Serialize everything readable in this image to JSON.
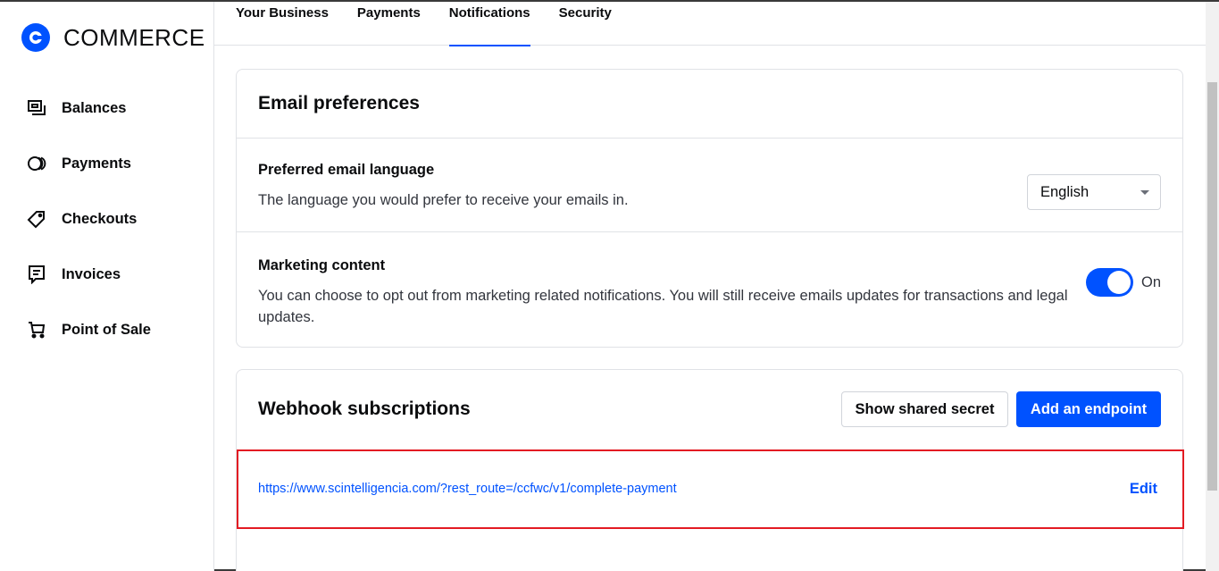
{
  "brand": {
    "name": "COMMERCE",
    "color": "#0052ff"
  },
  "sidebar": {
    "items": [
      {
        "label": "Balances",
        "icon": "balances-icon"
      },
      {
        "label": "Payments",
        "icon": "payments-icon"
      },
      {
        "label": "Checkouts",
        "icon": "checkouts-tag-icon"
      },
      {
        "label": "Invoices",
        "icon": "invoices-icon"
      },
      {
        "label": "Point of Sale",
        "icon": "cart-icon"
      }
    ]
  },
  "tabs": [
    {
      "label": "Your Business",
      "active": false
    },
    {
      "label": "Payments",
      "active": false
    },
    {
      "label": "Notifications",
      "active": true
    },
    {
      "label": "Security",
      "active": false
    }
  ],
  "email_preferences": {
    "title": "Email preferences",
    "language": {
      "title": "Preferred email language",
      "description": "The language you would prefer to receive your emails in.",
      "selected": "English"
    },
    "marketing": {
      "title": "Marketing content",
      "description": "You can choose to opt out from marketing related notifications. You will still receive emails updates for transactions and legal updates.",
      "toggle_state": "On",
      "enabled": true
    }
  },
  "webhooks": {
    "title": "Webhook subscriptions",
    "show_secret_label": "Show shared secret",
    "add_endpoint_label": "Add an endpoint",
    "endpoints": [
      {
        "url": "https://www.scintelligencia.com/?rest_route=/ccfwc/v1/complete-payment",
        "edit_label": "Edit"
      }
    ]
  },
  "colors": {
    "accent": "#0052ff",
    "highlight_border": "#e31b23"
  }
}
